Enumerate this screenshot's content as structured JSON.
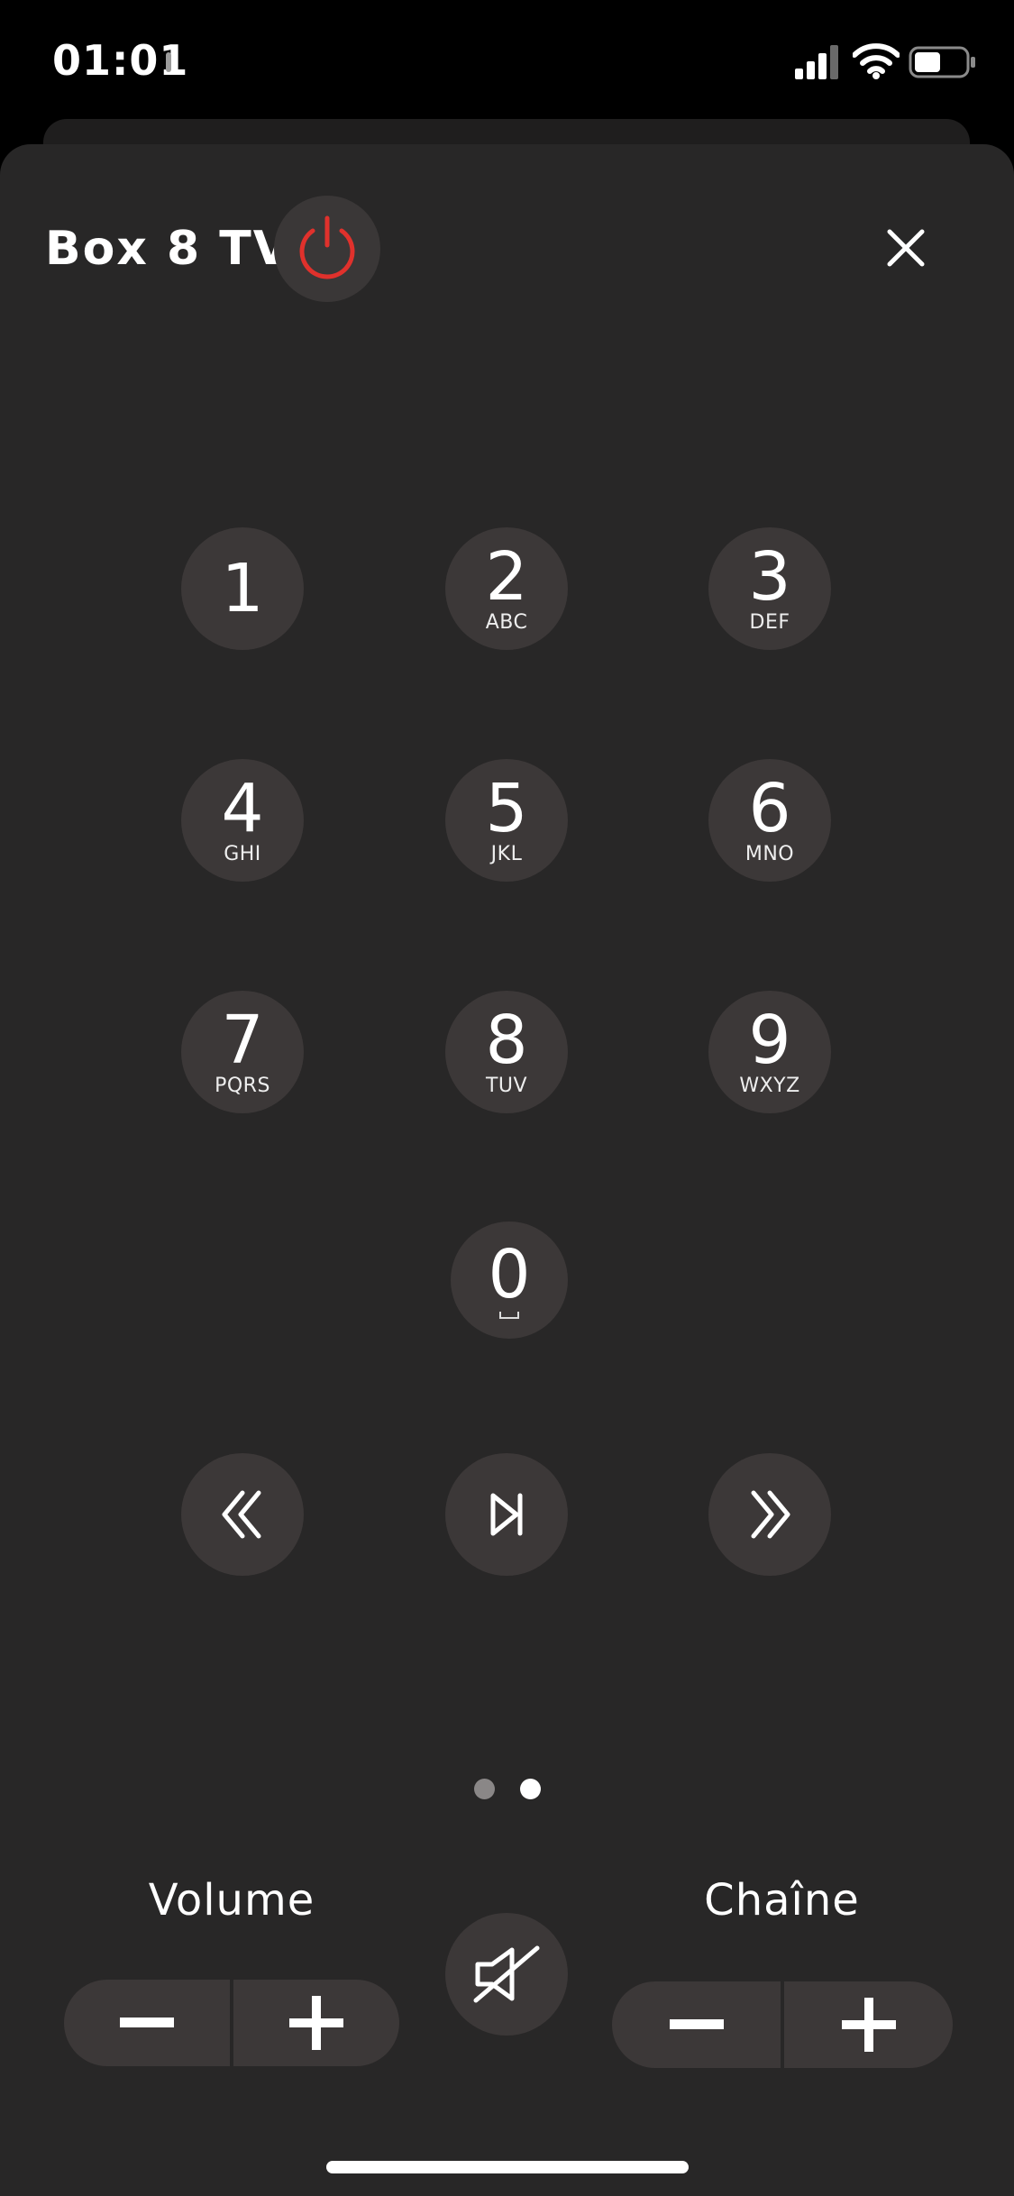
{
  "status": {
    "time": "01:01"
  },
  "header": {
    "device_name": "Box 8 TV"
  },
  "keypad": [
    {
      "digit": "1",
      "letters": ""
    },
    {
      "digit": "2",
      "letters": "ABC"
    },
    {
      "digit": "3",
      "letters": "DEF"
    },
    {
      "digit": "4",
      "letters": "GHI"
    },
    {
      "digit": "5",
      "letters": "JKL"
    },
    {
      "digit": "6",
      "letters": "MNO"
    },
    {
      "digit": "7",
      "letters": "PQRS"
    },
    {
      "digit": "8",
      "letters": "TUV"
    },
    {
      "digit": "9",
      "letters": "WXYZ"
    },
    {
      "digit": "0",
      "letters": ""
    }
  ],
  "transport": {
    "rewind": "rewind-icon",
    "play_pause": "play-pause-icon",
    "fast_forward": "fast-forward-icon"
  },
  "pager": {
    "count": 2,
    "active_index": 1
  },
  "volume": {
    "label": "Volume"
  },
  "channel": {
    "label": "Chaîne"
  },
  "colors": {
    "background": "#282727",
    "button": "#3c3838",
    "power": "#e0312c"
  }
}
